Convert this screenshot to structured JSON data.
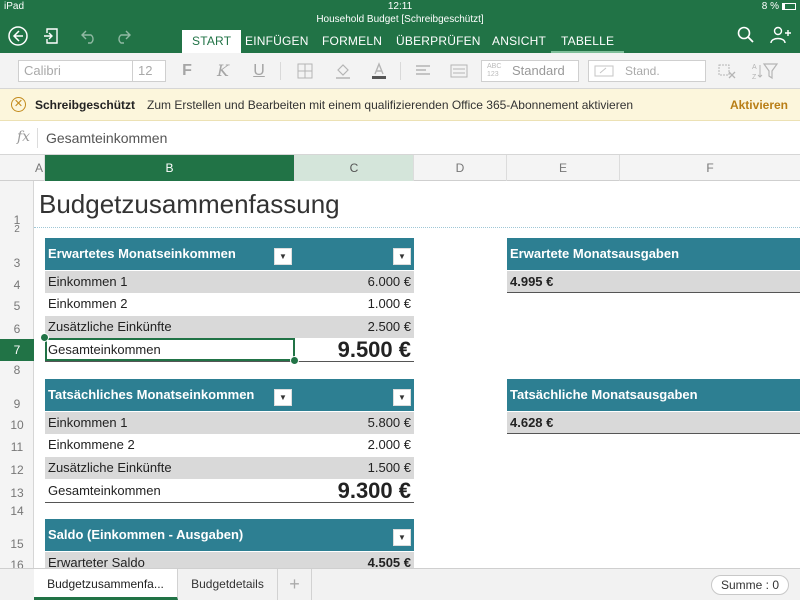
{
  "status_bar": {
    "device": "iPad",
    "time": "12:11",
    "battery": "8 %"
  },
  "header": {
    "document_title": "Household Budget [Schreibgeschützt]",
    "tabs": [
      "START",
      "EINFÜGEN",
      "FORMELN",
      "ÜBERPRÜFEN",
      "ANSICHT",
      "TABELLE"
    ],
    "active_tab": "START"
  },
  "toolbar": {
    "font_name": "Calibri",
    "font_size": "12",
    "bold": "F",
    "italic": "K",
    "underline": "U",
    "number_format_icon": "ABC 123",
    "number_format": "Standard",
    "cell_style": "Stand."
  },
  "infobar": {
    "title": "Schreibgeschützt",
    "message": "Zum Erstellen und Bearbeiten mit einem qualifizierenden Office 365-Abonnement aktivieren",
    "action": "Aktivieren"
  },
  "formula_bar": {
    "fx_label": "fx",
    "value": "Gesamteinkommen"
  },
  "columns": [
    "A",
    "B",
    "C",
    "D",
    "E",
    "F"
  ],
  "rows": [
    "1",
    "2",
    "3",
    "4",
    "5",
    "6",
    "7",
    "8",
    "9",
    "10",
    "11",
    "12",
    "13",
    "14",
    "15",
    "16"
  ],
  "sheet": {
    "title": "Budgetzusammenfassung",
    "expected_income": {
      "header": "Erwartetes Monatseinkommen",
      "rows": [
        {
          "label": "Einkommen 1",
          "value": "6.000 €"
        },
        {
          "label": "Einkommen 2",
          "value": "1.000 €"
        },
        {
          "label": "Zusätzliche Einkünfte",
          "value": "2.500 €"
        }
      ],
      "total_label": "Gesamteinkommen",
      "total_value": "9.500 €"
    },
    "actual_income": {
      "header": "Tatsächliches Monatseinkommen",
      "rows": [
        {
          "label": "Einkommen 1",
          "value": "5.800 €"
        },
        {
          "label": "Einkommene 2",
          "value": "2.000 €"
        },
        {
          "label": "Zusätzliche Einkünfte",
          "value": "1.500 €"
        }
      ],
      "total_label": "Gesamteinkommen",
      "total_value": "9.300 €"
    },
    "balance": {
      "header": "Saldo (Einkommen - Ausgaben)",
      "rows": [
        {
          "label": "Erwarteter Saldo",
          "value": "4.505 €"
        }
      ]
    },
    "expected_expenses": {
      "header": "Erwartete Monatsausgaben",
      "value": "4.995 €"
    },
    "actual_expenses": {
      "header": "Tatsächliche Monatsausgaben",
      "value": "4.628 €"
    }
  },
  "sheet_tabs": [
    "Budgetzusammenfa...",
    "Budgetdetails",
    "+"
  ],
  "status": {
    "sum": "Summe : 0"
  },
  "colors": {
    "excel_green": "#217346",
    "table_header": "#2d7f92",
    "info_bg": "#fcf6dc",
    "info_accent": "#b97e16"
  }
}
